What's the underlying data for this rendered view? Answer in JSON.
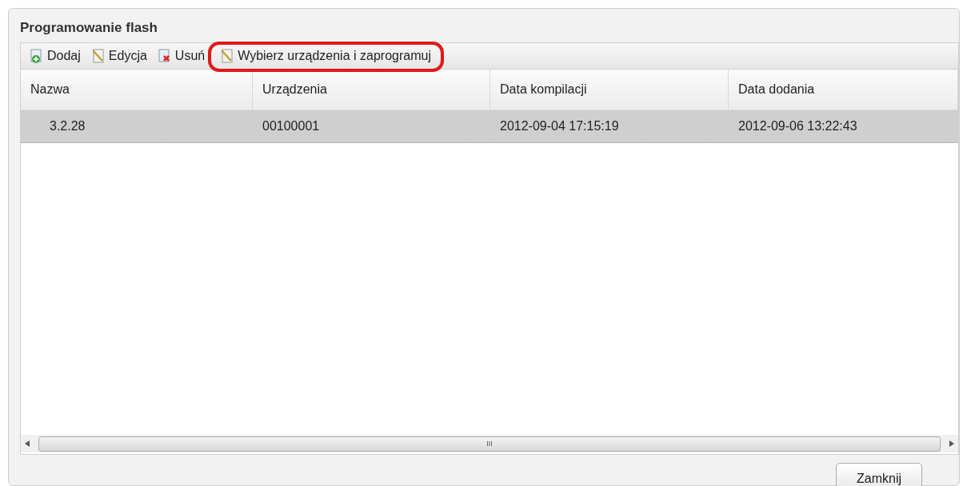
{
  "window": {
    "title": "Programowanie flash"
  },
  "toolbar": [
    {
      "label": "Dodaj",
      "kind": "add",
      "highlighted": false
    },
    {
      "label": "Edycja",
      "kind": "edit",
      "highlighted": false
    },
    {
      "label": "Usuń",
      "kind": "delete",
      "highlighted": false
    },
    {
      "label": "Wybierz urządzenia i zaprogramuj",
      "kind": "edit",
      "highlighted": true
    }
  ],
  "table": {
    "columns": [
      "Nazwa",
      "Urządzenia",
      "Data kompilacji",
      "Data dodania"
    ],
    "rows": [
      {
        "cells": [
          "3.2.28",
          "00100001",
          "2012-09-04 17:15:19",
          "2012-09-06 13:22:43"
        ],
        "selected": true
      }
    ]
  },
  "scrollbar": {
    "thumb_label": "III"
  },
  "buttons": [
    "Zamknij"
  ]
}
